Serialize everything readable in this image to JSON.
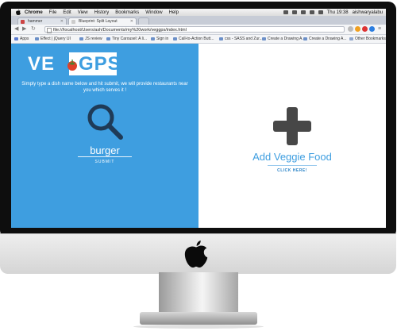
{
  "menubar": {
    "app": "Chrome",
    "items": [
      "File",
      "Edit",
      "View",
      "History",
      "Bookmarks",
      "Window",
      "Help"
    ],
    "clock": "Thu 19:38",
    "user": "aishwaryalabu"
  },
  "tabs": [
    {
      "title": "hammer"
    },
    {
      "title": "Blueprint: Split Layout"
    }
  ],
  "address": {
    "url": "file:///localhost/Users/ash/Documents/my%20work/veggps/index.html"
  },
  "bookmarks": {
    "items": [
      "Apps",
      "Effect | jQuery UI",
      "JS review",
      "Tiny Carousel: A li...",
      "Sign in",
      "Call-to-Action Butt...",
      "css - SASS and Zur...",
      "Create a Drawing A...",
      "Create a Drawing A..."
    ],
    "other": "Other Bookmarks"
  },
  "page": {
    "logo": {
      "part1": "VE",
      "part2": "GPS"
    },
    "tagline": "Simply type a dish name below and hit submit, we will provide restaurants near you which serves it !",
    "search_value": "burger",
    "submit_label": "SUBMIT",
    "add_title": "Add Veggie Food",
    "click_label": "CLICK HERE!"
  },
  "icons": [
    "apple-icon",
    "search-icon",
    "plus-icon",
    "tomato-icon"
  ],
  "colors": {
    "left_panel": "#3e9ee0",
    "right_panel": "#ffffff",
    "search_icon": "#1f3b57",
    "plus_icon": "#474747",
    "accent_text": "#3e9ee0"
  }
}
